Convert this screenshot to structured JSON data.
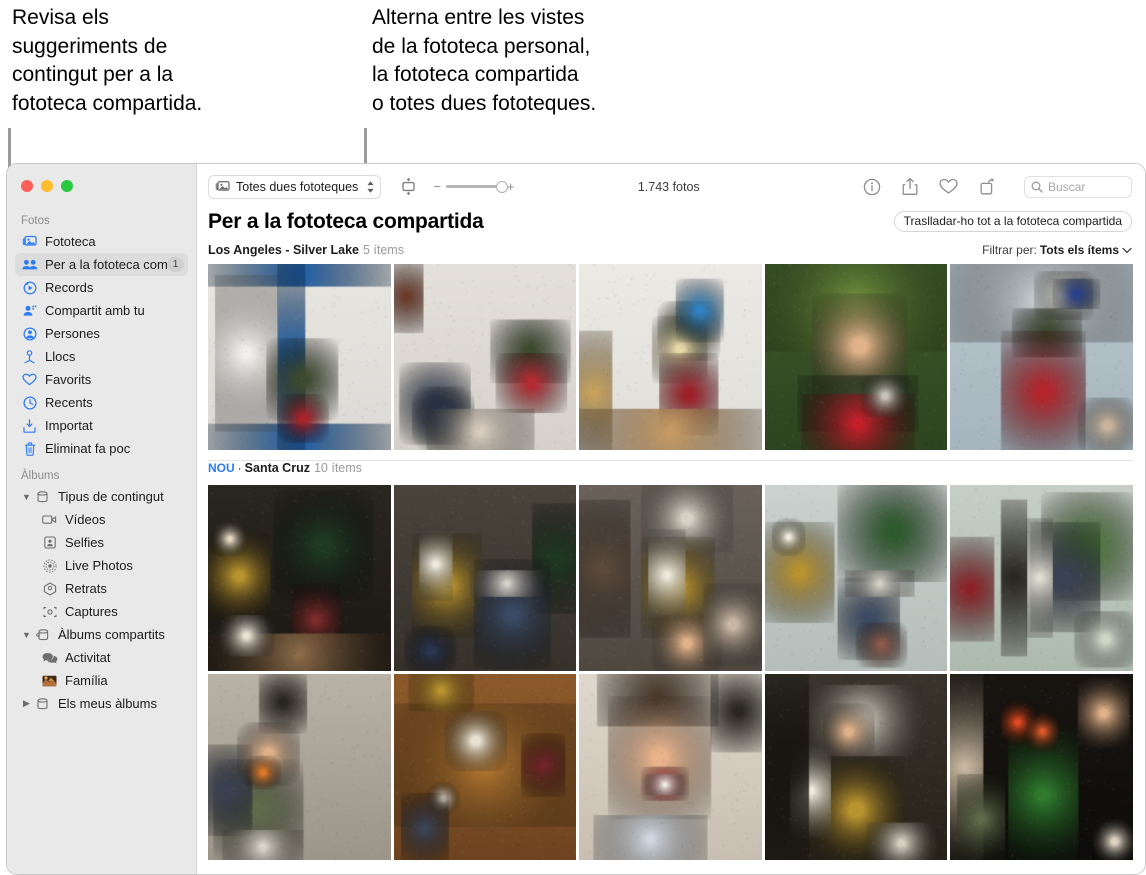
{
  "callouts": {
    "left": "Revisa els\nsuggeriments de\ncontingut per a la\nfototeca compartida.",
    "right": "Alterna entre les vistes\nde la fototeca personal,\nla fototeca compartida\no totes dues fototeques."
  },
  "window": {
    "traffic": {
      "close": "close-button",
      "minimize": "minimize-button",
      "zoom": "zoom-button"
    }
  },
  "sidebar": {
    "sections": [
      {
        "label": "Fotos",
        "items": [
          {
            "label": "Fototeca",
            "icon": "photos-library-icon",
            "selected": false,
            "badge": ""
          },
          {
            "label": "Per a la fototeca comp...",
            "icon": "shared-people-icon",
            "selected": true,
            "badge": "1"
          },
          {
            "label": "Records",
            "icon": "memories-icon",
            "selected": false,
            "badge": ""
          },
          {
            "label": "Compartit amb tu",
            "icon": "shared-with-you-icon",
            "selected": false,
            "badge": ""
          },
          {
            "label": "Persones",
            "icon": "people-icon",
            "selected": false,
            "badge": ""
          },
          {
            "label": "Llocs",
            "icon": "places-pin-icon",
            "selected": false,
            "badge": ""
          },
          {
            "label": "Favorits",
            "icon": "heart-icon",
            "selected": false,
            "badge": ""
          },
          {
            "label": "Recents",
            "icon": "clock-icon",
            "selected": false,
            "badge": ""
          },
          {
            "label": "Importat",
            "icon": "import-icon",
            "selected": false,
            "badge": ""
          },
          {
            "label": "Eliminat fa poc",
            "icon": "trash-icon",
            "selected": false,
            "badge": ""
          }
        ]
      },
      {
        "label": "Àlbums",
        "items": [
          {
            "label": "Tipus de contingut",
            "icon": "folder-icon",
            "twisty": "expanded",
            "indent": 0
          },
          {
            "label": "Vídeos",
            "icon": "video-icon",
            "indent": 1
          },
          {
            "label": "Selfies",
            "icon": "selfie-icon",
            "indent": 1
          },
          {
            "label": "Live Photos",
            "icon": "live-photo-icon",
            "indent": 1
          },
          {
            "label": "Retrats",
            "icon": "portrait-icon",
            "indent": 1
          },
          {
            "label": "Captures",
            "icon": "screenshot-icon",
            "indent": 1
          },
          {
            "label": "Àlbums compartits",
            "icon": "shared-folder-icon",
            "twisty": "expanded",
            "indent": 0
          },
          {
            "label": "Activitat",
            "icon": "activity-icon",
            "indent": 1
          },
          {
            "label": "Família",
            "icon": "family-album-thumb",
            "indent": 1
          },
          {
            "label": "Els meus àlbums",
            "icon": "folder-icon",
            "twisty": "collapsed",
            "indent": 0
          }
        ]
      }
    ]
  },
  "toolbar": {
    "library_selector": "Totes dues fototeques",
    "library_selector_icon": "photos-library-icon",
    "aspect_icon": "aspect-ratio-icon",
    "zoom_minus": "−",
    "zoom_plus": "+",
    "photo_count": "1.743 fotos",
    "info_icon": "info-icon",
    "share_icon": "share-icon",
    "favorite_icon": "heart-icon",
    "rotate_icon": "rotate-icon",
    "search_icon": "search-icon",
    "search_placeholder": "Buscar",
    "search_value": ""
  },
  "main": {
    "title": "Per a la fototeca compartida",
    "move_all_button": "Traslladar-ho tot a la fototeca compartida",
    "filter_label": "Filtrar per:",
    "filter_value": "Tots els ítems",
    "filter_chevron": "chevron-down-icon",
    "groups": [
      {
        "new_tag": "",
        "title": "Los Angeles - Silver Lake",
        "count": "5 ítems",
        "rows": [
          [
            "kid-hands-up-window",
            "two-kids-reading",
            "kid-playing-guitar",
            "kid-smiling-outside",
            "kid-with-megaphone"
          ]
        ]
      },
      {
        "new_tag": "NOU",
        "separator": "·",
        "title": "Santa Cruz",
        "count": "10 ítems",
        "rows": [
          [
            "mother-kid-kitchen-plants",
            "mother-helping-kid-baking",
            "mother-laughing-baking",
            "kids-at-window-table",
            "two-kids-by-window"
          ],
          [
            "kid-eating-orange",
            "hands-kneading-dough",
            "kid-floury-face",
            "mother-smiling-towel",
            "kid-baby-tulips"
          ]
        ]
      }
    ]
  },
  "colors": {
    "accent_blue": "#2b7cf6",
    "sidebar_bg": "#e9e9e9",
    "selected_bg": "#dcdcdc",
    "leader_gray": "#9a9a9a"
  }
}
